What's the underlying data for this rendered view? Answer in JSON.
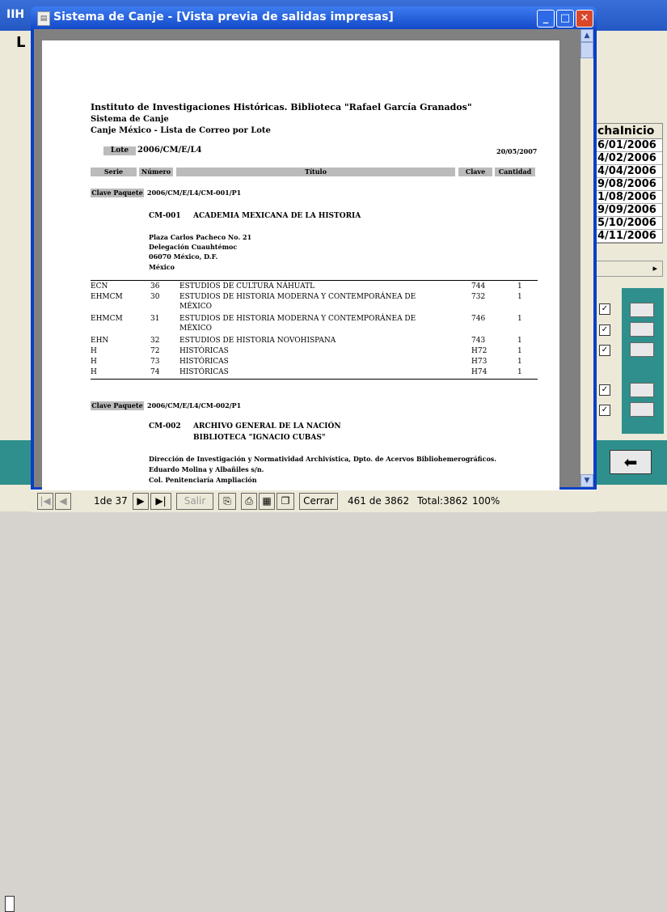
{
  "background_app": {
    "title": "IIH",
    "underline_char": "L",
    "date_column_header": "chaInicio",
    "dates": [
      "6/01/2006",
      "4/02/2006",
      "4/04/2006",
      "9/08/2006",
      "1/08/2006",
      "9/09/2006",
      "5/10/2006",
      "4/11/2006"
    ],
    "checkbox_mark": "✓",
    "back_arrow": "⬅"
  },
  "window": {
    "title": "Sistema de Canje - [Vista previa de salidas impresas]",
    "minimize": "_",
    "maximize": "□",
    "close": "✕"
  },
  "report": {
    "institution": "Instituto de Investigaciones Históricas. Biblioteca \"Rafael García Granados\"",
    "system": "Sistema de Canje",
    "subtitle": "Canje México - Lista de Correo por Lote",
    "lote_label": "Lote",
    "lote_value": "2006/CM/E/L4",
    "date": "20/05/2007",
    "columns": {
      "serie": "Serie",
      "numero": "Número",
      "titulo": "Título",
      "clave": "Clave",
      "cantidad": "Cantidad"
    },
    "paquete_label": "Clave Paquete",
    "paquete1": "2006/CM/E/L4/CM-001/P1",
    "entry1_code": "CM-001",
    "entry1_name": "ACADEMIA MEXICANA DE LA HISTORIA",
    "entry1_addr1": "Plaza Carlos Pacheco No. 21",
    "entry1_addr2": "Delegación Cuauhtémoc",
    "entry1_addr3": "06070 México, D.F.",
    "entry1_addr4": "México",
    "rows": [
      {
        "serie": "ECN",
        "num": "36",
        "titulo": "ESTUDIOS DE CULTURA NÁHUATL",
        "titulo2": "",
        "clave": "744",
        "cant": "1"
      },
      {
        "serie": "EHMCM",
        "num": "30",
        "titulo": "ESTUDIOS DE HISTORIA MODERNA Y CONTEMPORÁNEA DE",
        "titulo2": "MÉXICO",
        "clave": "732",
        "cant": "1"
      },
      {
        "serie": "EHMCM",
        "num": "31",
        "titulo": "ESTUDIOS DE HISTORIA MODERNA Y CONTEMPORÁNEA DE",
        "titulo2": "MÉXICO",
        "clave": "746",
        "cant": "1"
      },
      {
        "serie": "EHN",
        "num": "32",
        "titulo": "ESTUDIOS DE HISTORIA NOVOHISPANA",
        "titulo2": "",
        "clave": "743",
        "cant": "1"
      },
      {
        "serie": "H",
        "num": "72",
        "titulo": "HISTÓRICAS",
        "titulo2": "",
        "clave": "H72",
        "cant": "1"
      },
      {
        "serie": "H",
        "num": "73",
        "titulo": "HISTÓRICAS",
        "titulo2": "",
        "clave": "H73",
        "cant": "1"
      },
      {
        "serie": "H",
        "num": "74",
        "titulo": "HISTÓRICAS",
        "titulo2": "",
        "clave": "H74",
        "cant": "1"
      }
    ],
    "paquete2": "2006/CM/E/L4/CM-002/P1",
    "entry2_code": "CM-002",
    "entry2_name": "ARCHIVO GENERAL DE LA NACIÓN",
    "entry2_name2": "BIBLIOTECA \"IGNACIO CUBAS\"",
    "entry2_addr1": "Dirección de Investigación y Normatividad Archivística, Dpto. de Acervos Bibliohemerográficos.",
    "entry2_addr2": "Eduardo Molina y Albañiles s/n.",
    "entry2_addr3": "Col. Penitenciaría Ampliación"
  },
  "toolbar": {
    "first": "|◀",
    "prev": "◀",
    "page_label": "1de 37",
    "next": "▶",
    "last": "▶|",
    "exit": "Salir",
    "close": "Cerrar",
    "record_info": "461 de 3862",
    "total": "Total:3862",
    "zoom": "100%"
  }
}
